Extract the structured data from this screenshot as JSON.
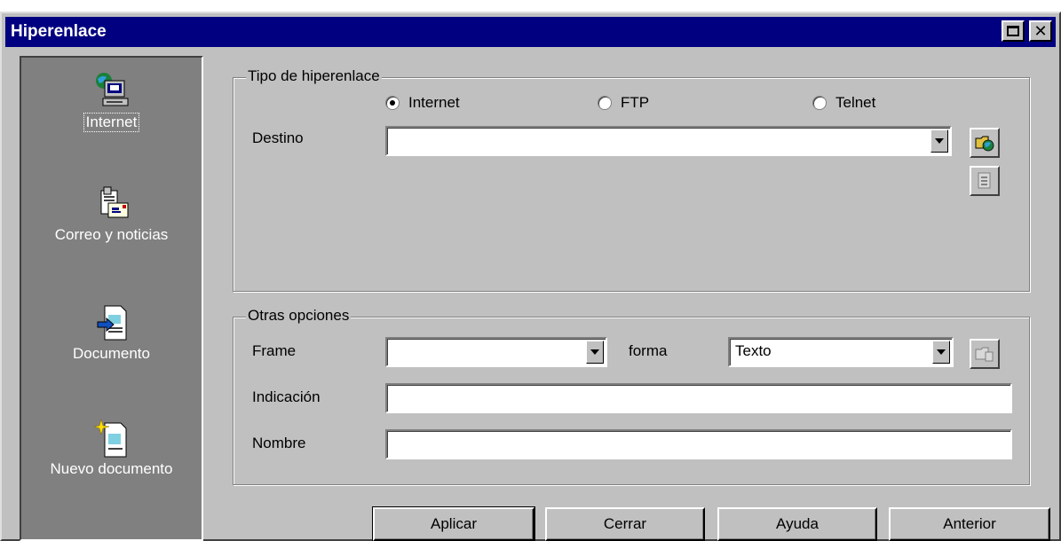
{
  "window": {
    "title": "Hiperenlace"
  },
  "sidebar": {
    "items": [
      {
        "label": "Internet",
        "icon": "globe-computer-icon",
        "selected": true
      },
      {
        "label": "Correo y noticias",
        "icon": "mail-news-icon",
        "selected": false
      },
      {
        "label": "Documento",
        "icon": "document-icon",
        "selected": false
      },
      {
        "label": "Nuevo documento",
        "icon": "new-document-icon",
        "selected": false
      }
    ]
  },
  "link_type": {
    "legend": "Tipo de hiperenlace",
    "options": [
      {
        "label": "Internet",
        "selected": true
      },
      {
        "label": "FTP",
        "selected": false
      },
      {
        "label": "Telnet",
        "selected": false
      }
    ],
    "destino_label": "Destino",
    "destino_value": ""
  },
  "other_options": {
    "legend": "Otras opciones",
    "frame_label": "Frame",
    "frame_value": "",
    "forma_label": "forma",
    "forma_value": "Texto",
    "indicacion_label": "Indicación",
    "indicacion_value": "",
    "nombre_label": "Nombre",
    "nombre_value": ""
  },
  "buttons": {
    "apply": "Aplicar",
    "close": "Cerrar",
    "help": "Ayuda",
    "back": "Anterior"
  },
  "colors": {
    "titlebar": "#000080",
    "face": "#c0c0c0",
    "sidebar": "#808080"
  }
}
